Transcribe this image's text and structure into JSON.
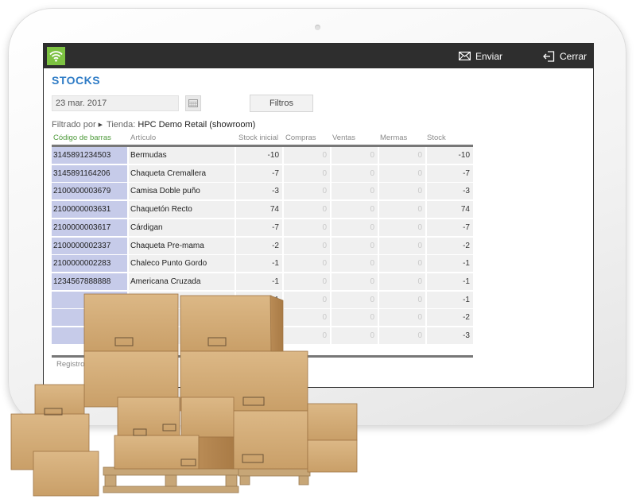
{
  "header": {
    "enviar_label": "Enviar",
    "cerrar_label": "Cerrar",
    "accent_color": "#7dc242"
  },
  "page": {
    "title": "STOCKS",
    "date_value": "23 mar. 2017",
    "filter_button_label": "Filtros",
    "filter_by_label": "Filtrado por",
    "store_label": "Tienda:",
    "store_value": "HPC Demo Retail (showroom)",
    "registros_label": "Registros"
  },
  "table": {
    "columns": [
      "Código de barras",
      "Artículo",
      "Stock inicial",
      "Compras",
      "Ventas",
      "Mermas",
      "Stock"
    ],
    "rows": [
      [
        "3145891234503",
        "Bermudas",
        "-10",
        "0",
        "0",
        "0",
        "-10"
      ],
      [
        "3145891164206",
        "Chaqueta Cremallera",
        "-7",
        "0",
        "0",
        "0",
        "-7"
      ],
      [
        "2100000003679",
        "Camisa Doble puño",
        "-3",
        "0",
        "0",
        "0",
        "-3"
      ],
      [
        "2100000003631",
        "Chaquetón Recto",
        "74",
        "0",
        "0",
        "0",
        "74"
      ],
      [
        "2100000003617",
        "Cárdigan",
        "-7",
        "0",
        "0",
        "0",
        "-7"
      ],
      [
        "2100000002337",
        "Chaqueta Pre-mama",
        "-2",
        "0",
        "0",
        "0",
        "-2"
      ],
      [
        "2100000002283",
        "Chaleco Punto Gordo",
        "-1",
        "0",
        "0",
        "0",
        "-1"
      ],
      [
        "1234567888888",
        "Americana Cruzada",
        "-1",
        "0",
        "0",
        "0",
        "-1"
      ],
      [
        "",
        "",
        "-1",
        "0",
        "0",
        "0",
        "-1"
      ],
      [
        "",
        "",
        "-2",
        "0",
        "0",
        "0",
        "-2"
      ],
      [
        "",
        "",
        "-3",
        "0",
        "0",
        "0",
        "-3"
      ]
    ]
  },
  "icons": {
    "wifi": "wifi-icon",
    "envelope": "envelope-icon",
    "logout": "logout-icon",
    "calendar": "calendar-icon",
    "boxes": "cardboard-boxes-illustration"
  }
}
